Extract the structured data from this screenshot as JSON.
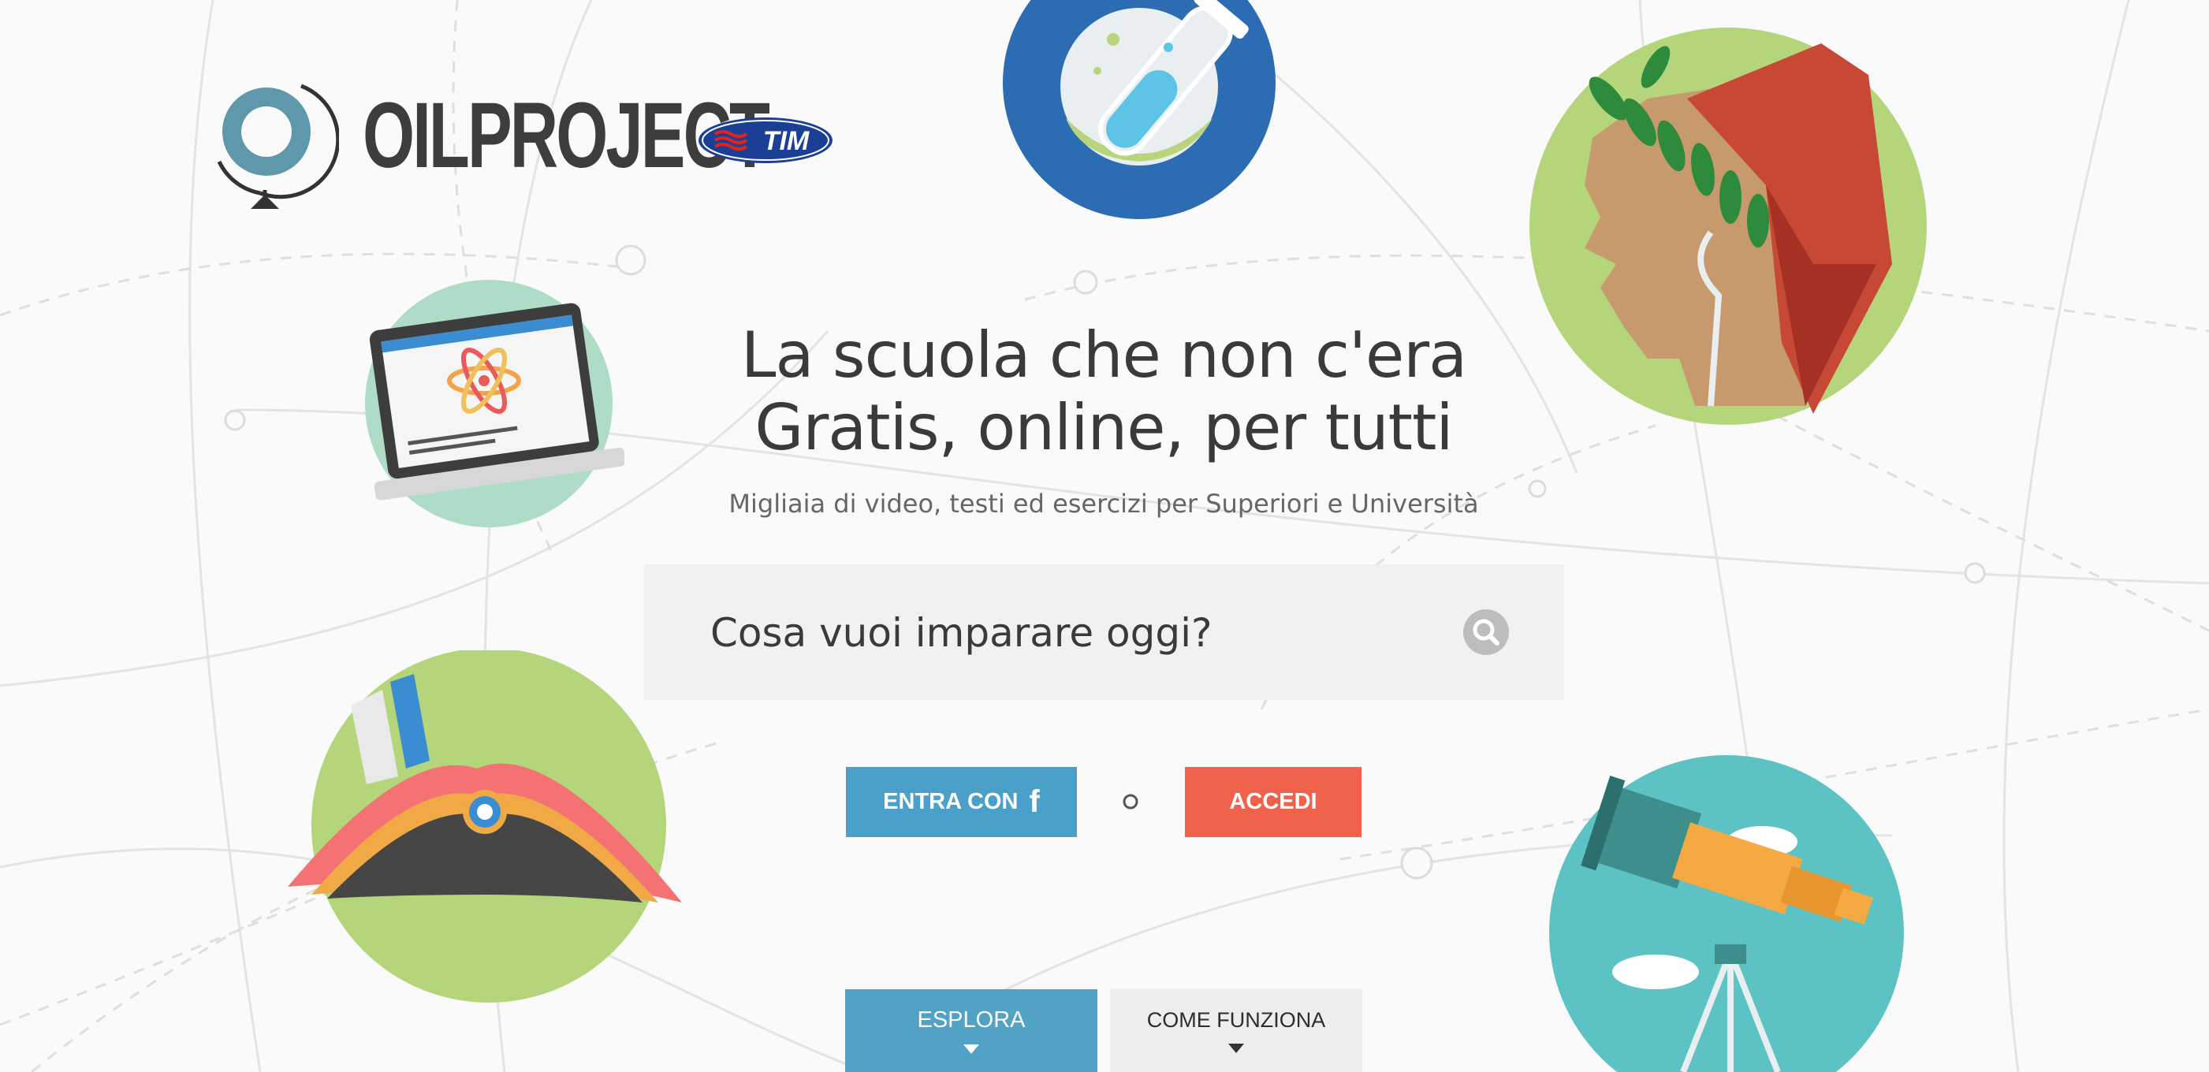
{
  "brand": {
    "name": "OILPROJECT",
    "partner": "TIM"
  },
  "hero": {
    "title_line1": "La scuola che non c'era",
    "title_line2": "Gratis, online, per tutti",
    "subtitle": "Migliaia di video, testi ed esercizi per Superiori e Università"
  },
  "search": {
    "placeholder": "Cosa vuoi imparare oggi?"
  },
  "auth": {
    "facebook_label": "ENTRA CON",
    "facebook_icon": "facebook-f-icon",
    "or_label": "o",
    "login_label": "ACCEDI"
  },
  "nav": {
    "explore_label": "ESPLORA",
    "how_label": "COME FUNZIONA"
  },
  "colors": {
    "facebook_blue": "#4aa0c9",
    "login_red": "#f0624c",
    "explore_blue": "#51a2c5",
    "search_bg": "#f1f1f2",
    "background": "#fafafa"
  },
  "illustrations": [
    "chemistry-flask-icon",
    "laptop-atom-icon",
    "dante-laurel-icon",
    "napoleon-hat-icon",
    "telescope-icon"
  ]
}
